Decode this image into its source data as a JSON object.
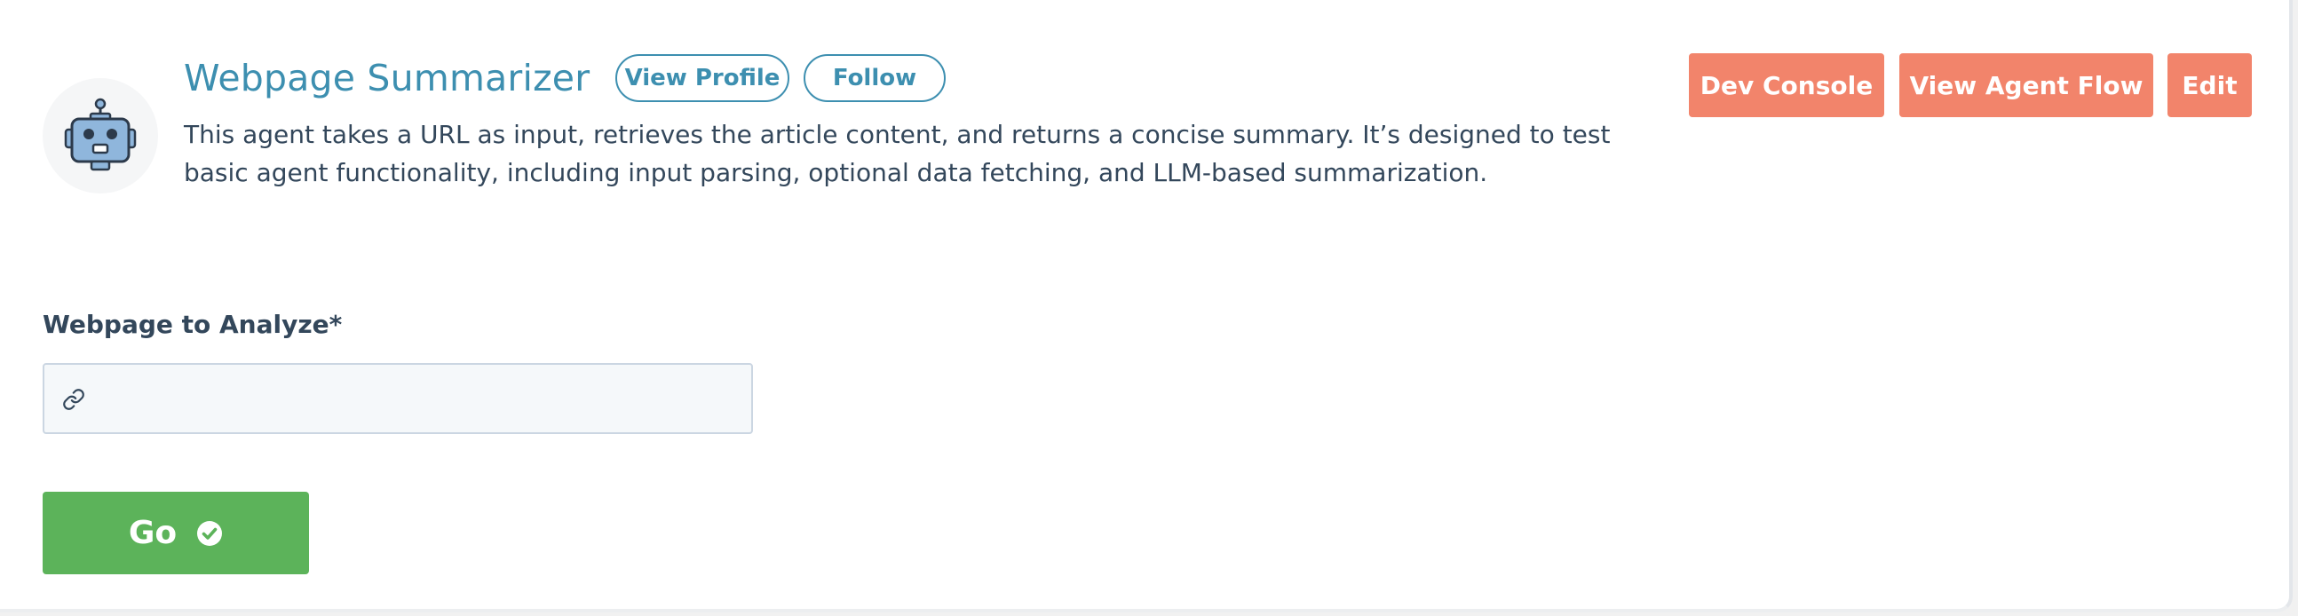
{
  "agent": {
    "title": "Webpage Summarizer",
    "description": "This agent takes a URL as input, retrieves the article content, and returns a concise summary. It’s designed to test basic agent functionality, including input parsing, optional data fetching, and LLM-based summarization.",
    "avatar_icon": "robot-icon"
  },
  "header_links": {
    "view_profile": "View Profile",
    "follow": "Follow"
  },
  "actions": {
    "dev_console": "Dev Console",
    "view_agent_flow": "View Agent Flow",
    "edit": "Edit"
  },
  "form": {
    "field_label": "Webpage to Analyze*",
    "field_value": "",
    "field_icon": "link-icon",
    "submit_label": "Go",
    "submit_icon": "check-circle-icon"
  },
  "colors": {
    "title": "#3d8fb0",
    "action_buttons": "#f2846b",
    "submit_button": "#5cb35a",
    "text": "#33475b"
  }
}
